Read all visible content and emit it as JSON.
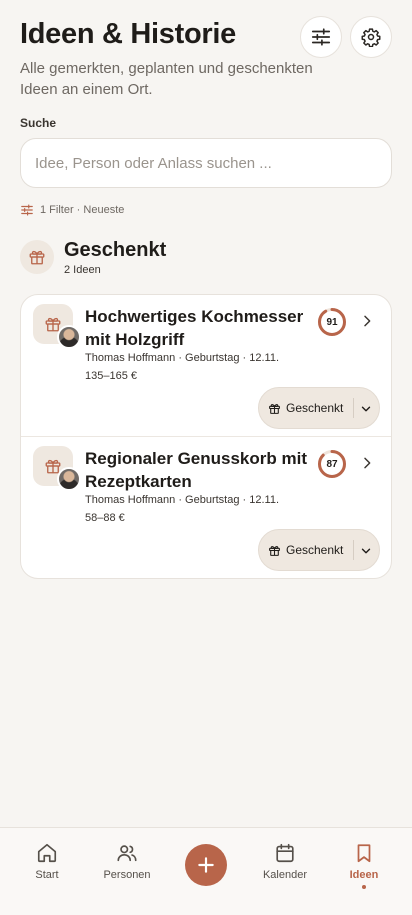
{
  "header": {
    "title": "Ideen & Historie",
    "subtitle": "Alle gemerkten, geplanten und geschenkten Ideen an einem Ort.",
    "filter_icon": "sliders-icon",
    "settings_icon": "gear-icon"
  },
  "search": {
    "label": "Suche",
    "placeholder": "Idee, Person oder Anlass suchen ...",
    "value": ""
  },
  "filters": {
    "summary": "1 Filter · Neueste",
    "icon": "sliders-icon"
  },
  "section": {
    "title": "Geschenkt",
    "count": "2 Ideen",
    "icon": "gift-icon"
  },
  "items": [
    {
      "title": "Hochwertiges Kochmesser mit Holzgriff",
      "meta": "Thomas Hoffmann · Geburtstag · 12.11.",
      "price": "135–165 €",
      "score": "91",
      "score_fraction": 0.91,
      "status": "Geschenkt"
    },
    {
      "title": "Regionaler Genusskorb mit Rezeptkarten",
      "meta": "Thomas Hoffmann · Geburtstag · 12.11.",
      "price": "58–88 €",
      "score": "87",
      "score_fraction": 0.87,
      "status": "Geschenkt"
    }
  ],
  "tabbar": {
    "start": "Start",
    "people": "Personen",
    "calendar": "Kalender",
    "ideas": "Ideen",
    "active": "ideas"
  },
  "colors": {
    "accent": "#b8654a",
    "background": "#f7f5f2",
    "card": "#ffffff"
  }
}
